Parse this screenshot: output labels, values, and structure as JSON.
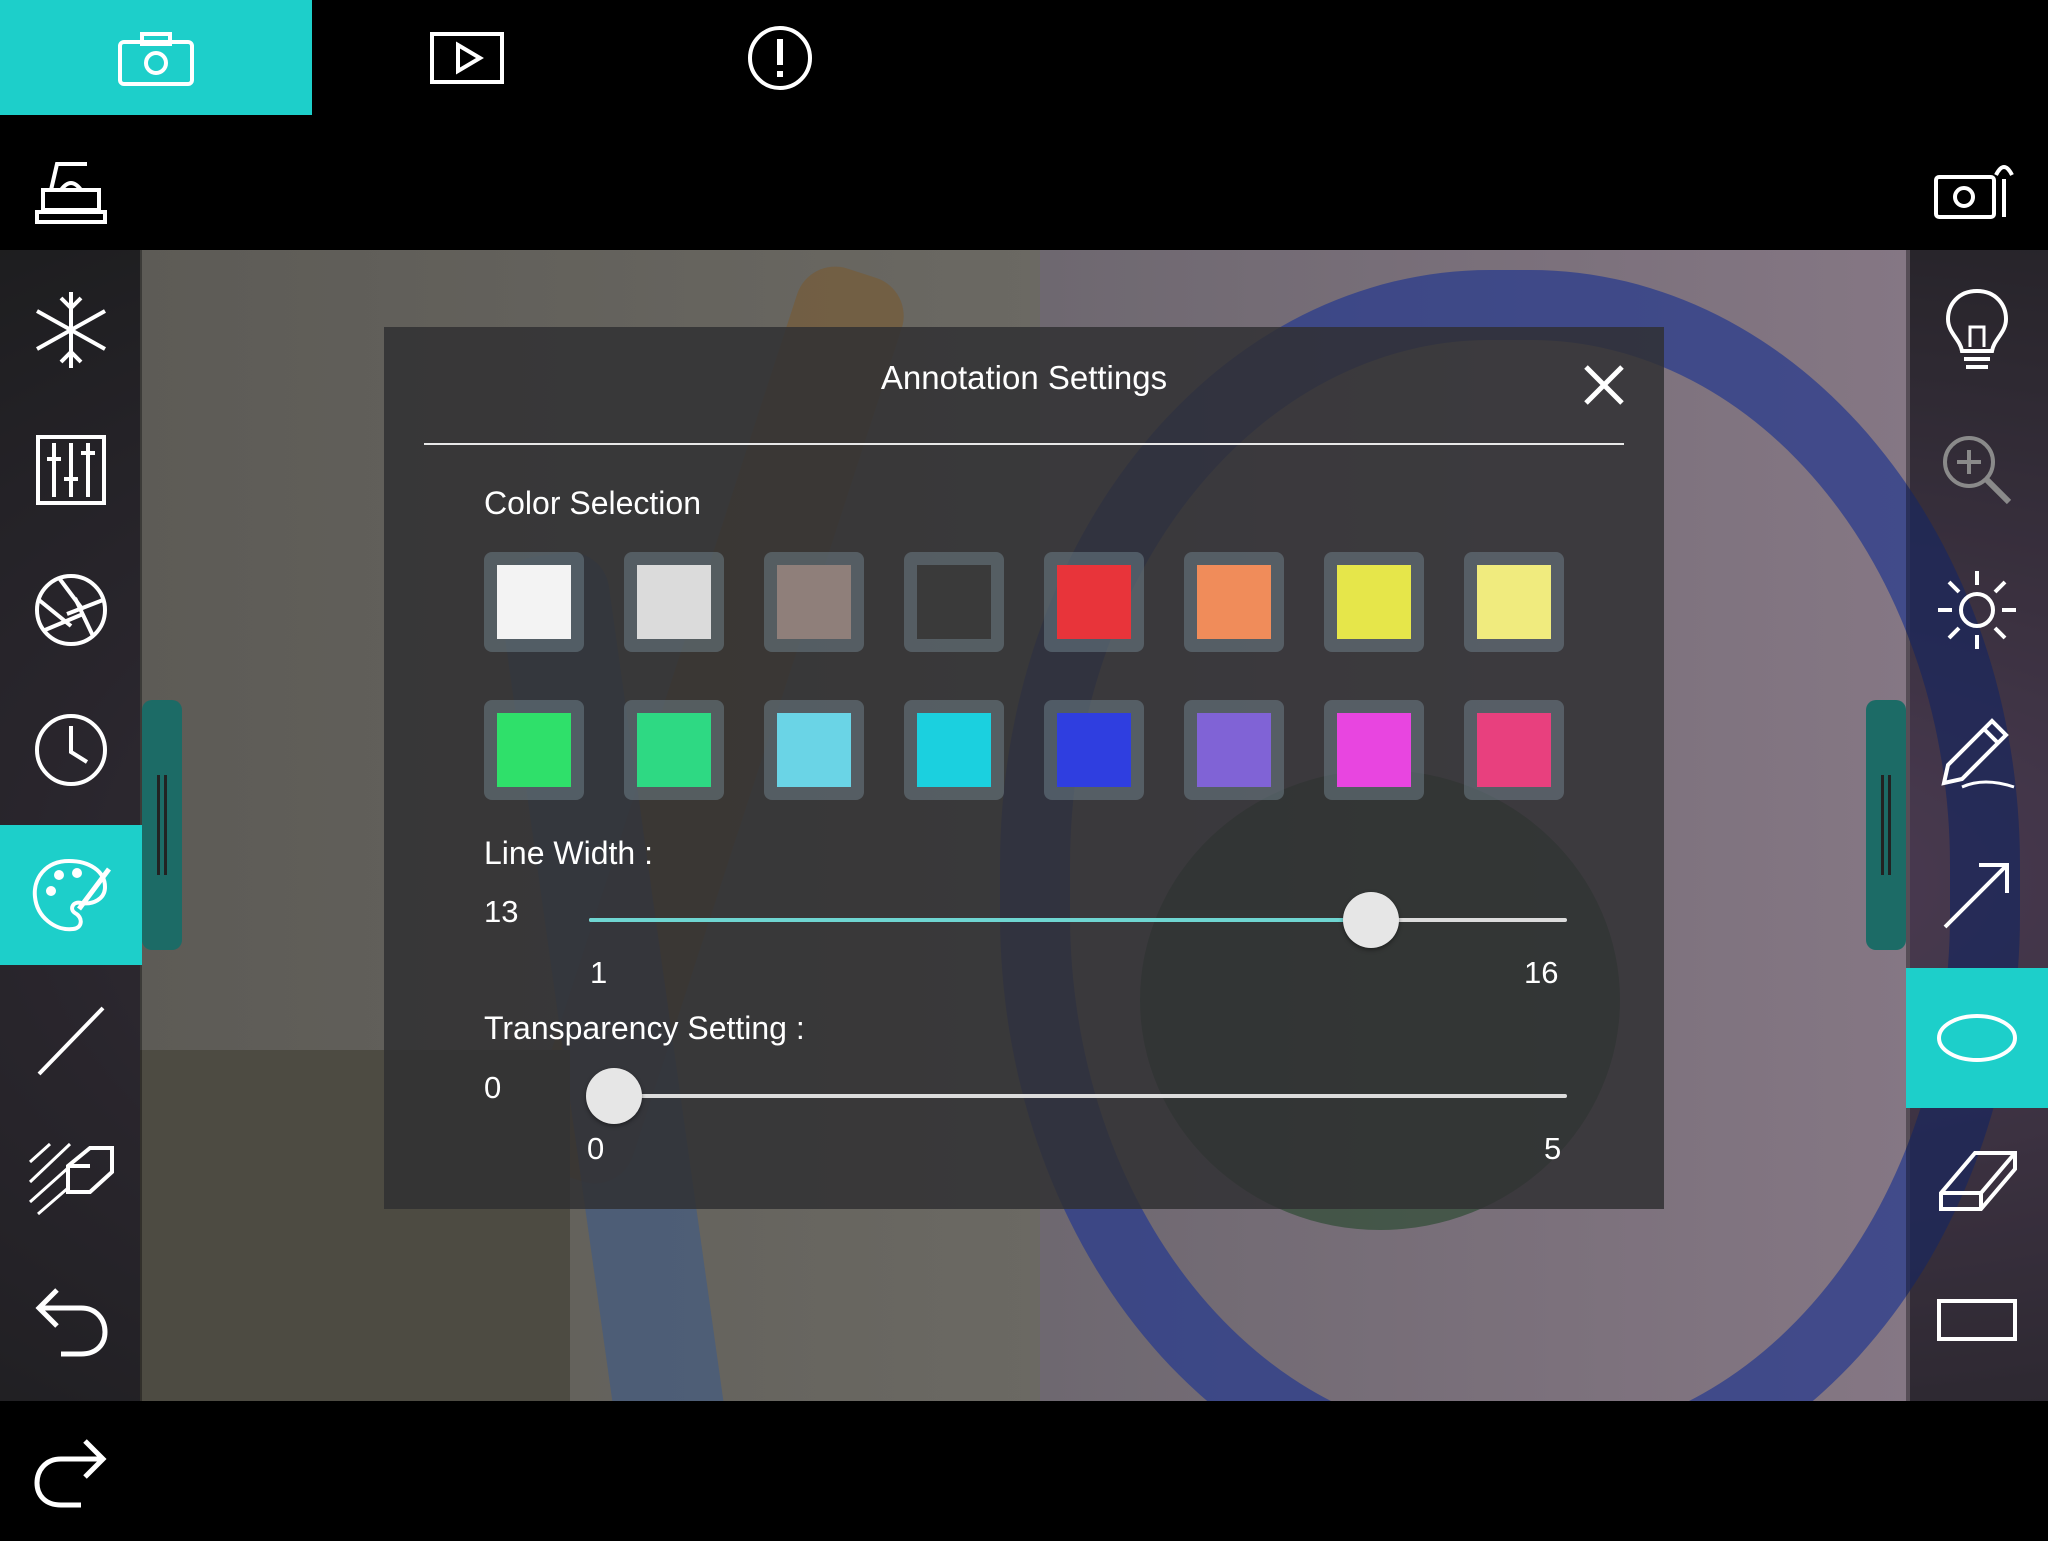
{
  "tabs": [
    {
      "icon": "camera-icon",
      "active": true
    },
    {
      "icon": "play-icon",
      "active": false
    },
    {
      "icon": "info-icon",
      "active": false
    }
  ],
  "left_toolbar": [
    "document-camera-icon",
    "freeze-icon",
    "adjustments-icon",
    "aperture-icon",
    "timer-icon",
    "palette-icon",
    "line-icon",
    "texture-eraser-icon",
    "undo-icon",
    "redo-icon"
  ],
  "right_toolbar": [
    "camera-settings-icon",
    "light-bulb-icon",
    "zoom-in-icon",
    "brightness-icon",
    "pen-icon",
    "arrow-icon",
    "ellipse-icon",
    "eraser-icon",
    "rectangle-icon"
  ],
  "accent_color": "#1dcfca",
  "dialog": {
    "title": "Annotation Settings",
    "color_section_label": "Color Selection",
    "colors": [
      "#f3f3f3",
      "#dbdbdb",
      "#8f7f7a",
      "#3a3a3a",
      "#e8343a",
      "#f08c5a",
      "#e6e64a",
      "#f0eb7e",
      "#2fe06a",
      "#2ed983",
      "#6ad4e6",
      "#1bd0df",
      "#2f3ee0",
      "#8063d6",
      "#e845e0",
      "#e8407e"
    ],
    "line_width": {
      "label": "Line Width :",
      "value": "13",
      "min": "1",
      "max": "16",
      "fraction": 0.8
    },
    "transparency": {
      "label": "Transparency Setting :",
      "value": "0",
      "min": "0",
      "max": "5",
      "fraction": 0.0
    }
  }
}
